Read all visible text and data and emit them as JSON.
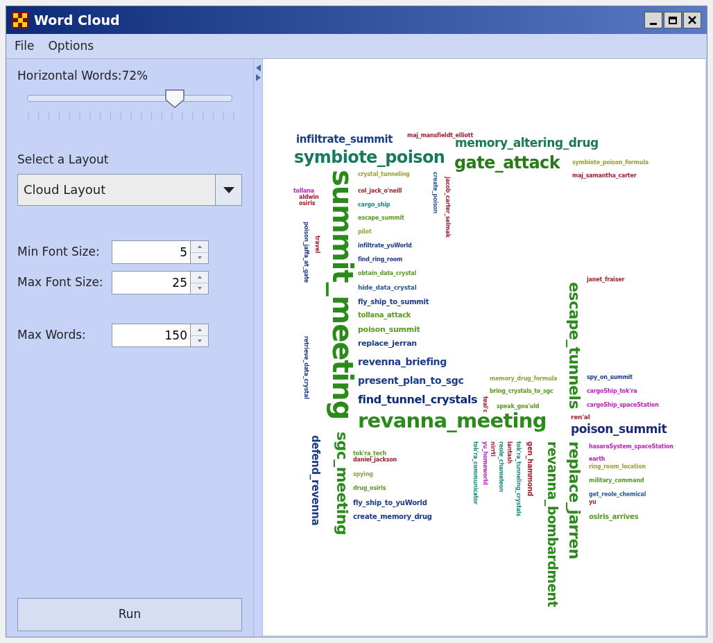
{
  "window": {
    "title": "Word Cloud"
  },
  "menu": [
    {
      "label": "File"
    },
    {
      "label": "Options"
    }
  ],
  "controls": {
    "slider_label": "Horizontal Words:72%",
    "slider": {
      "level": 0.72
    },
    "layout_label": "Select a Layout",
    "layout_value": "Cloud Layout",
    "fields": [
      {
        "label": "Min Font Size:",
        "value": "5"
      },
      {
        "label": "Max Font Size:",
        "value": "25"
      },
      {
        "label": "Max Words:",
        "value": "150"
      }
    ],
    "run_button": "Run"
  },
  "cloud": [
    {
      "text": "infiltrate_summit",
      "kind": "horizontal",
      "color": "#1a3a8a"
    },
    {
      "text": "maj_mansfieldt_elliott",
      "kind": "horizontal",
      "color": "#a02030"
    },
    {
      "text": "memory_altering_drug",
      "kind": "horizontal",
      "color": "#1a7a50"
    },
    {
      "text": "symbiote_poison",
      "kind": "horizontal",
      "color": "#1a7a60"
    },
    {
      "text": "gate_attack",
      "kind": "horizontal",
      "color": "#2a7a1a"
    },
    {
      "text": "symbiote_poison_formula",
      "kind": "horizontal",
      "color": "#9aa030"
    },
    {
      "text": "summit_meeting",
      "kind": "vertical",
      "color": "#2a8a1a"
    },
    {
      "text": "crystal_tunneling",
      "kind": "horizontal",
      "color": "#9aa030"
    },
    {
      "text": "create_poison",
      "kind": "vertical",
      "color": "#2a5a9a"
    },
    {
      "text": "jacob_carter_selmak",
      "kind": "vertical",
      "color": "#a02030"
    },
    {
      "text": "maj_samantha_carter",
      "kind": "horizontal",
      "color": "#a02030"
    },
    {
      "text": "tollana",
      "kind": "horizontal",
      "color": "#c020c0"
    },
    {
      "text": "col_jack_o'neill",
      "kind": "horizontal",
      "color": "#a02030"
    },
    {
      "text": "aldwin",
      "kind": "horizontal",
      "color": "#a02030"
    },
    {
      "text": "osiris",
      "kind": "horizontal",
      "color": "#a02030"
    },
    {
      "text": "cargo_ship",
      "kind": "horizontal",
      "color": "#1a8a80"
    },
    {
      "text": "escape_summit",
      "kind": "horizontal",
      "color": "#5a9a20"
    },
    {
      "text": "poison_jaffa_at_gate",
      "kind": "vertical",
      "color": "#1a3a8a"
    },
    {
      "text": "pilot",
      "kind": "horizontal",
      "color": "#9aa030"
    },
    {
      "text": "travel",
      "kind": "vertical",
      "color": "#a02030"
    },
    {
      "text": "infiltrate_yuWorld",
      "kind": "horizontal",
      "color": "#1a3a8a"
    },
    {
      "text": "find_ring_room",
      "kind": "horizontal",
      "color": "#1a3a8a"
    },
    {
      "text": "obtain_data_crystal",
      "kind": "horizontal",
      "color": "#5a9a20"
    },
    {
      "text": "janet_fraiser",
      "kind": "horizontal",
      "color": "#a02030"
    },
    {
      "text": "hide_data_crystal",
      "kind": "horizontal",
      "color": "#2a5a9a"
    },
    {
      "text": "escape_tunnels",
      "kind": "vertical",
      "color": "#2a8a1a"
    },
    {
      "text": "fly_ship_to_summit",
      "kind": "horizontal",
      "color": "#1a3a8a"
    },
    {
      "text": "tollana_attack",
      "kind": "horizontal",
      "color": "#5a9a20"
    },
    {
      "text": "poison_summit",
      "kind": "horizontal",
      "color": "#5a9a20"
    },
    {
      "text": "retrieve_data_crystal",
      "kind": "vertical",
      "color": "#1a3a8a"
    },
    {
      "text": "replace_jerran",
      "kind": "horizontal",
      "color": "#1a3a8a"
    },
    {
      "text": "revenna_briefing",
      "kind": "horizontal",
      "color": "#1a3a8a"
    },
    {
      "text": "present_plan_to_sgc",
      "kind": "horizontal",
      "color": "#1a3a8a"
    },
    {
      "text": "memory_drug_formula",
      "kind": "horizontal",
      "color": "#9aa030"
    },
    {
      "text": "spy_on_summit",
      "kind": "horizontal",
      "color": "#1a3a8a"
    },
    {
      "text": "bring_crystals_to_sgc",
      "kind": "horizontal",
      "color": "#5a9a20"
    },
    {
      "text": "cargoShip_tok'ra",
      "kind": "horizontal",
      "color": "#c020c0"
    },
    {
      "text": "find_tunnel_crystals",
      "kind": "horizontal",
      "color": "#0a2a7a"
    },
    {
      "text": "teal'c",
      "kind": "vertical",
      "color": "#a02030"
    },
    {
      "text": "speak_goa'uld",
      "kind": "horizontal",
      "color": "#5a9a20"
    },
    {
      "text": "cargoShip_spaceStation",
      "kind": "horizontal",
      "color": "#c020c0"
    },
    {
      "text": "revanna_meeting",
      "kind": "horizontal",
      "color": "#2a8a1a"
    },
    {
      "text": "ren'al",
      "kind": "horizontal",
      "color": "#a02030"
    },
    {
      "text": "poison_summit",
      "kind": "horizontal",
      "color": "#1a2a7a"
    },
    {
      "text": "defend_revenna",
      "kind": "vertical",
      "color": "#1a3a8a"
    },
    {
      "text": "sgc_meeting",
      "kind": "vertical",
      "color": "#2a8a1a"
    },
    {
      "text": "tok'ra_communicator",
      "kind": "vertical",
      "color": "#1a8a80"
    },
    {
      "text": "yu_homeworld",
      "kind": "vertical",
      "color": "#c020c0"
    },
    {
      "text": "nirrti",
      "kind": "vertical",
      "color": "#a02030"
    },
    {
      "text": "reole_chameleon",
      "kind": "vertical",
      "color": "#1a8a80"
    },
    {
      "text": "lantash",
      "kind": "vertical",
      "color": "#a02030"
    },
    {
      "text": "tok'ra_tunneling_crystals",
      "kind": "vertical",
      "color": "#1a8a80"
    },
    {
      "text": "gen_hammond",
      "kind": "vertical",
      "color": "#a02030"
    },
    {
      "text": "revanna_bombardment",
      "kind": "vertical",
      "color": "#2a8a1a"
    },
    {
      "text": "replace_jarren",
      "kind": "vertical",
      "color": "#2a8a1a"
    },
    {
      "text": "hasaraSystem_spaceStation",
      "kind": "horizontal",
      "color": "#c020c0"
    },
    {
      "text": "tok'ra_tech",
      "kind": "horizontal",
      "color": "#5a9a20"
    },
    {
      "text": "daniel_jackson",
      "kind": "horizontal",
      "color": "#a02030"
    },
    {
      "text": "earth",
      "kind": "horizontal",
      "color": "#c020c0"
    },
    {
      "text": "ring_room_location",
      "kind": "horizontal",
      "color": "#9aa030"
    },
    {
      "text": "spying",
      "kind": "horizontal",
      "color": "#9aa030"
    },
    {
      "text": "military_command",
      "kind": "horizontal",
      "color": "#5a9a20"
    },
    {
      "text": "drug_osiris",
      "kind": "horizontal",
      "color": "#5a9a20"
    },
    {
      "text": "get_reole_chemical",
      "kind": "horizontal",
      "color": "#2a5a9a"
    },
    {
      "text": "fly_ship_to_yuWorld",
      "kind": "horizontal",
      "color": "#1a3a8a"
    },
    {
      "text": "yu",
      "kind": "horizontal",
      "color": "#a02030"
    },
    {
      "text": "create_memory_drug",
      "kind": "horizontal",
      "color": "#1a3a8a"
    },
    {
      "text": "osiris_arrives",
      "kind": "horizontal",
      "color": "#5a9a20"
    }
  ]
}
